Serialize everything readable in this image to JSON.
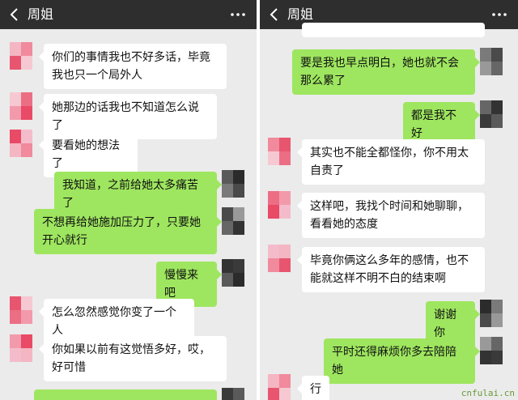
{
  "header": {
    "title": "周姐"
  },
  "colors": {
    "header_bg": "#2e2e2e",
    "incoming_bubble": "#ffffff",
    "outgoing_bubble": "#9ee65f",
    "chat_bg": "#ebebeb"
  },
  "icons": {
    "back": "chevron-left-icon",
    "more": "more-dots-icon"
  },
  "left_messages": [
    {
      "side": "in",
      "text": "你们的事情我也不好多话，毕竟我也只一个局外人"
    },
    {
      "side": "in",
      "text": "她那边的话我也不知道怎么说了"
    },
    {
      "side": "in",
      "text": "要看她的想法了"
    },
    {
      "side": "out",
      "text": "我知道，之前给她太多痛苦了"
    },
    {
      "side": "out",
      "text": "不想再给她施加压力了，只要她开心就行"
    },
    {
      "side": "out",
      "text": "慢慢来吧"
    },
    {
      "side": "in",
      "text": "怎么忽然感觉你变了一个人"
    },
    {
      "side": "in",
      "text": "你如果以前有这觉悟多好，哎，好可惜"
    }
  ],
  "right_messages": [
    {
      "side": "out",
      "text": "要是我也早点明白，她也就不会那么累了"
    },
    {
      "side": "out",
      "text": "都是我不好"
    },
    {
      "side": "in",
      "text": "其实也不能全都怪你，你不用太自责了"
    },
    {
      "side": "in",
      "text": "这样吧，我找个时间和她聊聊，看看她的态度"
    },
    {
      "side": "in",
      "text": "毕竟你俩这么多年的感情，也不能就这样不明不白的结束啊"
    },
    {
      "side": "out",
      "text": "谢谢你"
    },
    {
      "side": "out",
      "text": "平时还得麻烦你多去陪陪她"
    },
    {
      "side": "in",
      "text": "行"
    }
  ],
  "watermark": "cnfulai.cn"
}
